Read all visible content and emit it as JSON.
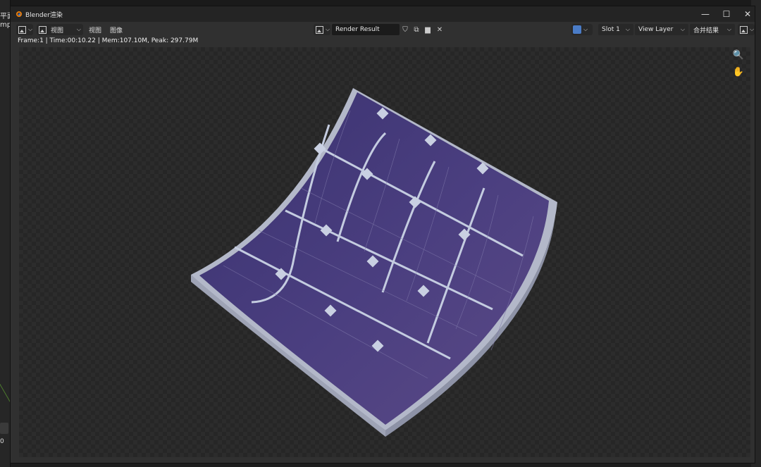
{
  "background_app": {
    "left_fragments": [
      "平面",
      "mple"
    ],
    "left_field": "0"
  },
  "window": {
    "title": "Blender渲染",
    "controls": {
      "minimize": "—",
      "maximize": "☐",
      "close": "✕"
    }
  },
  "header": {
    "view_menu": "视图",
    "menu_items": [
      "视图",
      "图像"
    ],
    "image_name": "Render Result",
    "slot": "Slot 1",
    "view_layer": "View Layer",
    "pass": "合并结果"
  },
  "stats": "Frame:1 | Time:00:10.22 | Mem:107.10M, Peak: 297.79M",
  "render": {
    "panel_cell_color": "#4a3d7a",
    "panel_grid_color": "#c4cce0",
    "frame_color": "#aeb3c4"
  }
}
